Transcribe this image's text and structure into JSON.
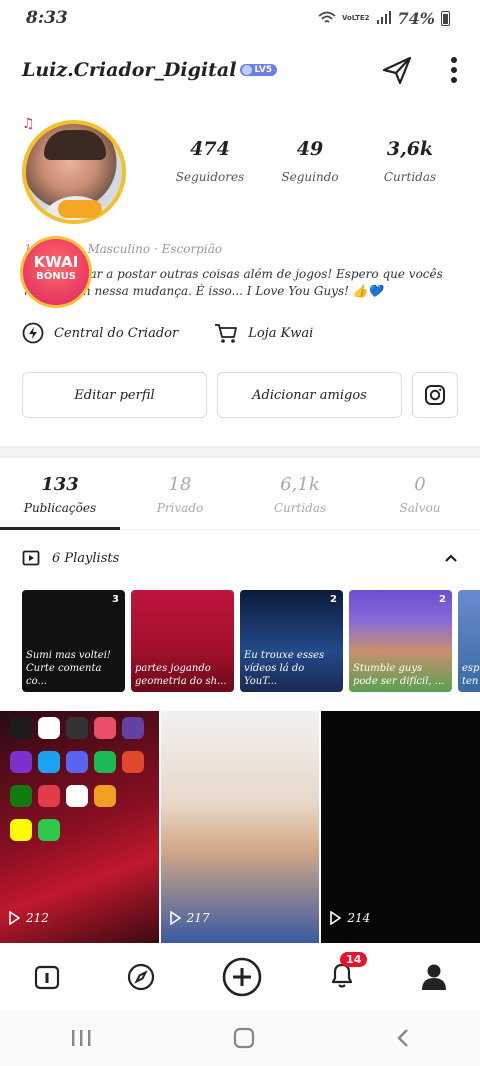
{
  "status_bar": {
    "time": "8:33",
    "network": "VoLTE2",
    "battery": "74%"
  },
  "header": {
    "username": "Luiz.Criador_Digital",
    "level_badge": "LV5"
  },
  "stats": [
    {
      "value": "474",
      "label": "Seguidores"
    },
    {
      "value": "49",
      "label": "Seguindo"
    },
    {
      "value": "3,6k",
      "label": "Curtidas"
    }
  ],
  "profile": {
    "meta": "19 years · Masculino · Escorpião",
    "bio": "Vou começar a postar outras coisas além de jogos! Espero que vocês me apoiem nessa mudança. É isso... I Love You Guys! 👍💙",
    "kwai_bonus_line1": "KWAI",
    "kwai_bonus_line2": "BÔNUS"
  },
  "links": {
    "creator_center": "Central do Criador",
    "kwai_shop": "Loja Kwai"
  },
  "buttons": {
    "edit_profile": "Editar perfil",
    "add_friends": "Adicionar amigos"
  },
  "tabs": [
    {
      "count": "133",
      "label": "Publicações",
      "active": true
    },
    {
      "count": "18",
      "label": "Privado",
      "active": false
    },
    {
      "count": "6,1k",
      "label": "Curtidas",
      "active": false
    },
    {
      "count": "0",
      "label": "Salvou",
      "active": false
    }
  ],
  "playlists_header": "6 Playlists",
  "playlists": [
    {
      "count": "3",
      "caption": "Sumi mas voltei! Curte comenta co..."
    },
    {
      "count": "",
      "caption": "partes jogando geometria do sh..."
    },
    {
      "count": "2",
      "caption": "Eu trouxe esses vídeos lá do YouT..."
    },
    {
      "count": "2",
      "caption": "Stumble guys pode ser difícil, ..."
    },
    {
      "count": "",
      "caption": "esp ten"
    }
  ],
  "videos": [
    {
      "views": "212"
    },
    {
      "views": "217"
    },
    {
      "views": "214"
    }
  ],
  "bottom_nav": {
    "notification_count": "14"
  },
  "colors": {
    "accent_red": "#e8142c",
    "level_blue": "#6d7fe8",
    "avatar_ring": "#f4c02a"
  }
}
